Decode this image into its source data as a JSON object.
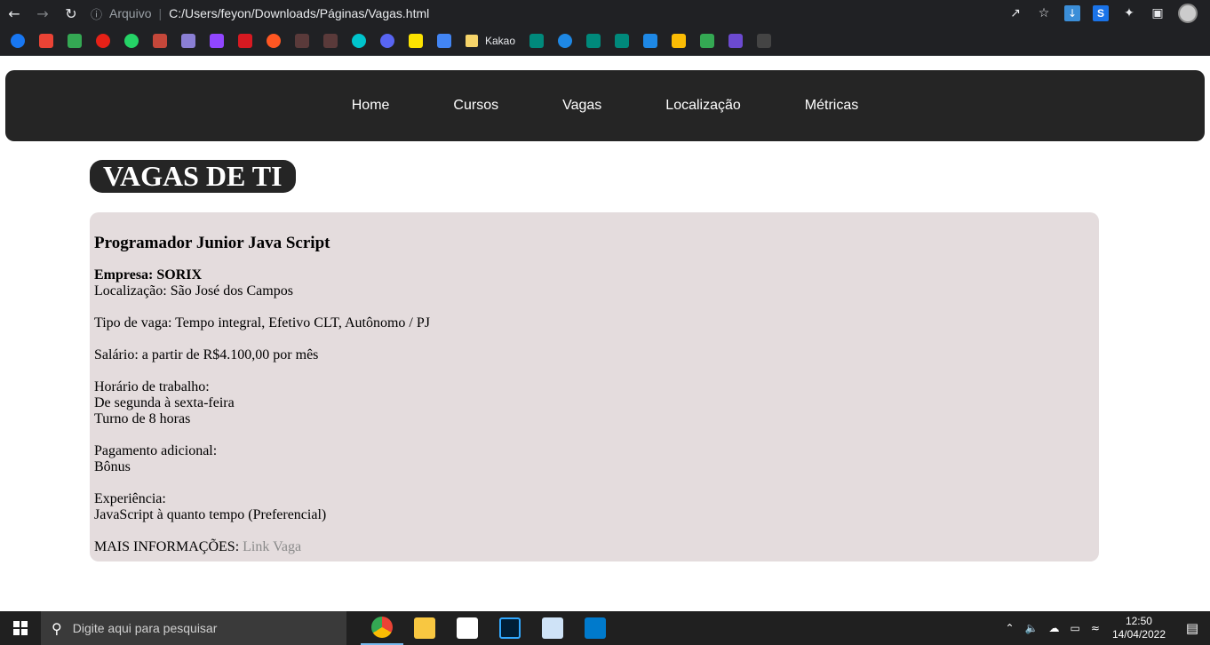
{
  "browser": {
    "address_info_label": "Arquivo",
    "address_url": "C:/Users/feyon/Downloads/Páginas/Vagas.html",
    "bookmark_folder_label": "Kakao"
  },
  "nav": {
    "items": [
      "Home",
      "Cursos",
      "Vagas",
      "Localização",
      "Métricas"
    ]
  },
  "page": {
    "title": "VAGAS DE TI"
  },
  "job": {
    "title": "Programador Junior Java Script",
    "empresa": "Empresa: SORIX",
    "localizacao": "Localização: São José dos Campos",
    "tipo": "Tipo de vaga: Tempo integral, Efetivo CLT, Autônomo / PJ",
    "salario": "Salário: a partir de R$4.100,00 por mês",
    "horario_label": "Horário de trabalho:",
    "horario_dias": "De segunda à sexta-feira",
    "horario_turno": "Turno de 8 horas",
    "pagamento_label": "Pagamento adicional:",
    "pagamento_valor": "Bônus",
    "experiencia_label": "Experiência:",
    "experiencia_valor": "JavaScript à quanto tempo (Preferencial)",
    "mais_info_label": "MAIS INFORMAÇÕES:",
    "link_text": "Link Vaga"
  },
  "taskbar": {
    "search_placeholder": "Digite aqui para pesquisar",
    "time": "12:50",
    "date": "14/04/2022"
  },
  "colors": {
    "nav_bg": "#252525",
    "card_bg": "#e4dcdd",
    "link": "#8a8a8a"
  }
}
